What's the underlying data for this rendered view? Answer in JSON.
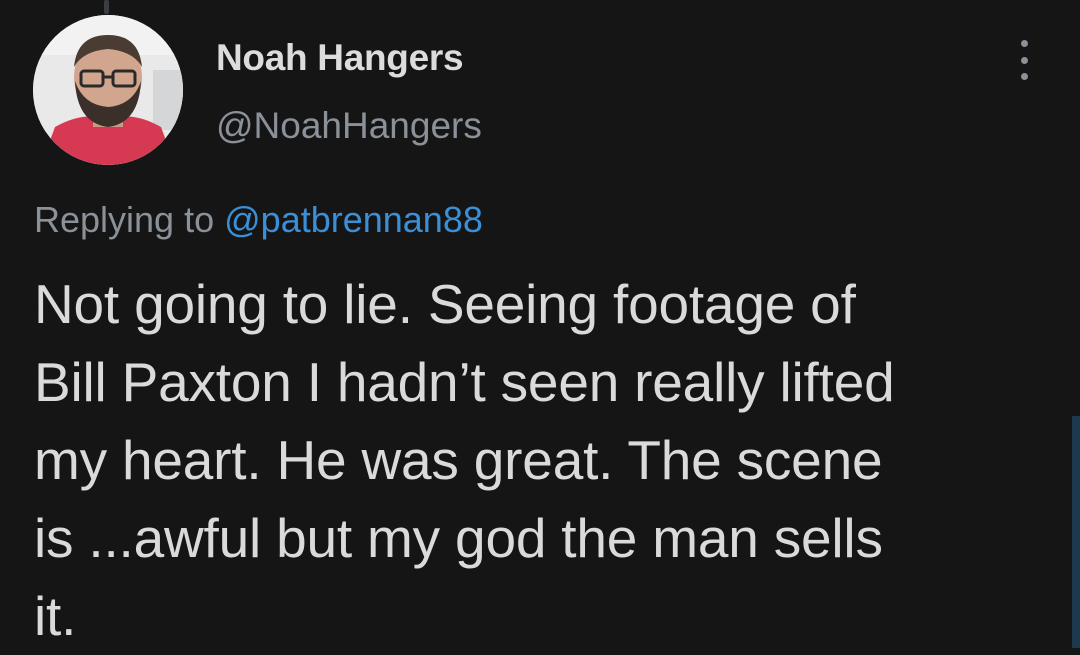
{
  "tweet": {
    "author": {
      "display_name": "Noah Hangers",
      "handle": "@NoahHangers"
    },
    "replying_prefix": "Replying to",
    "replying_to": "@patbrennan88",
    "text_lines": [
      "Not going to lie. Seeing footage of",
      "Bill Paxton I hadn’t seen really lifted",
      "my heart. He was great. The scene",
      "is ...awful but my god the man sells",
      "it."
    ]
  },
  "icons": {
    "more": "more-vertical-icon"
  },
  "colors": {
    "background": "#151515",
    "text": "#dadada",
    "muted": "#8a9199",
    "link": "#3b8fd6"
  }
}
